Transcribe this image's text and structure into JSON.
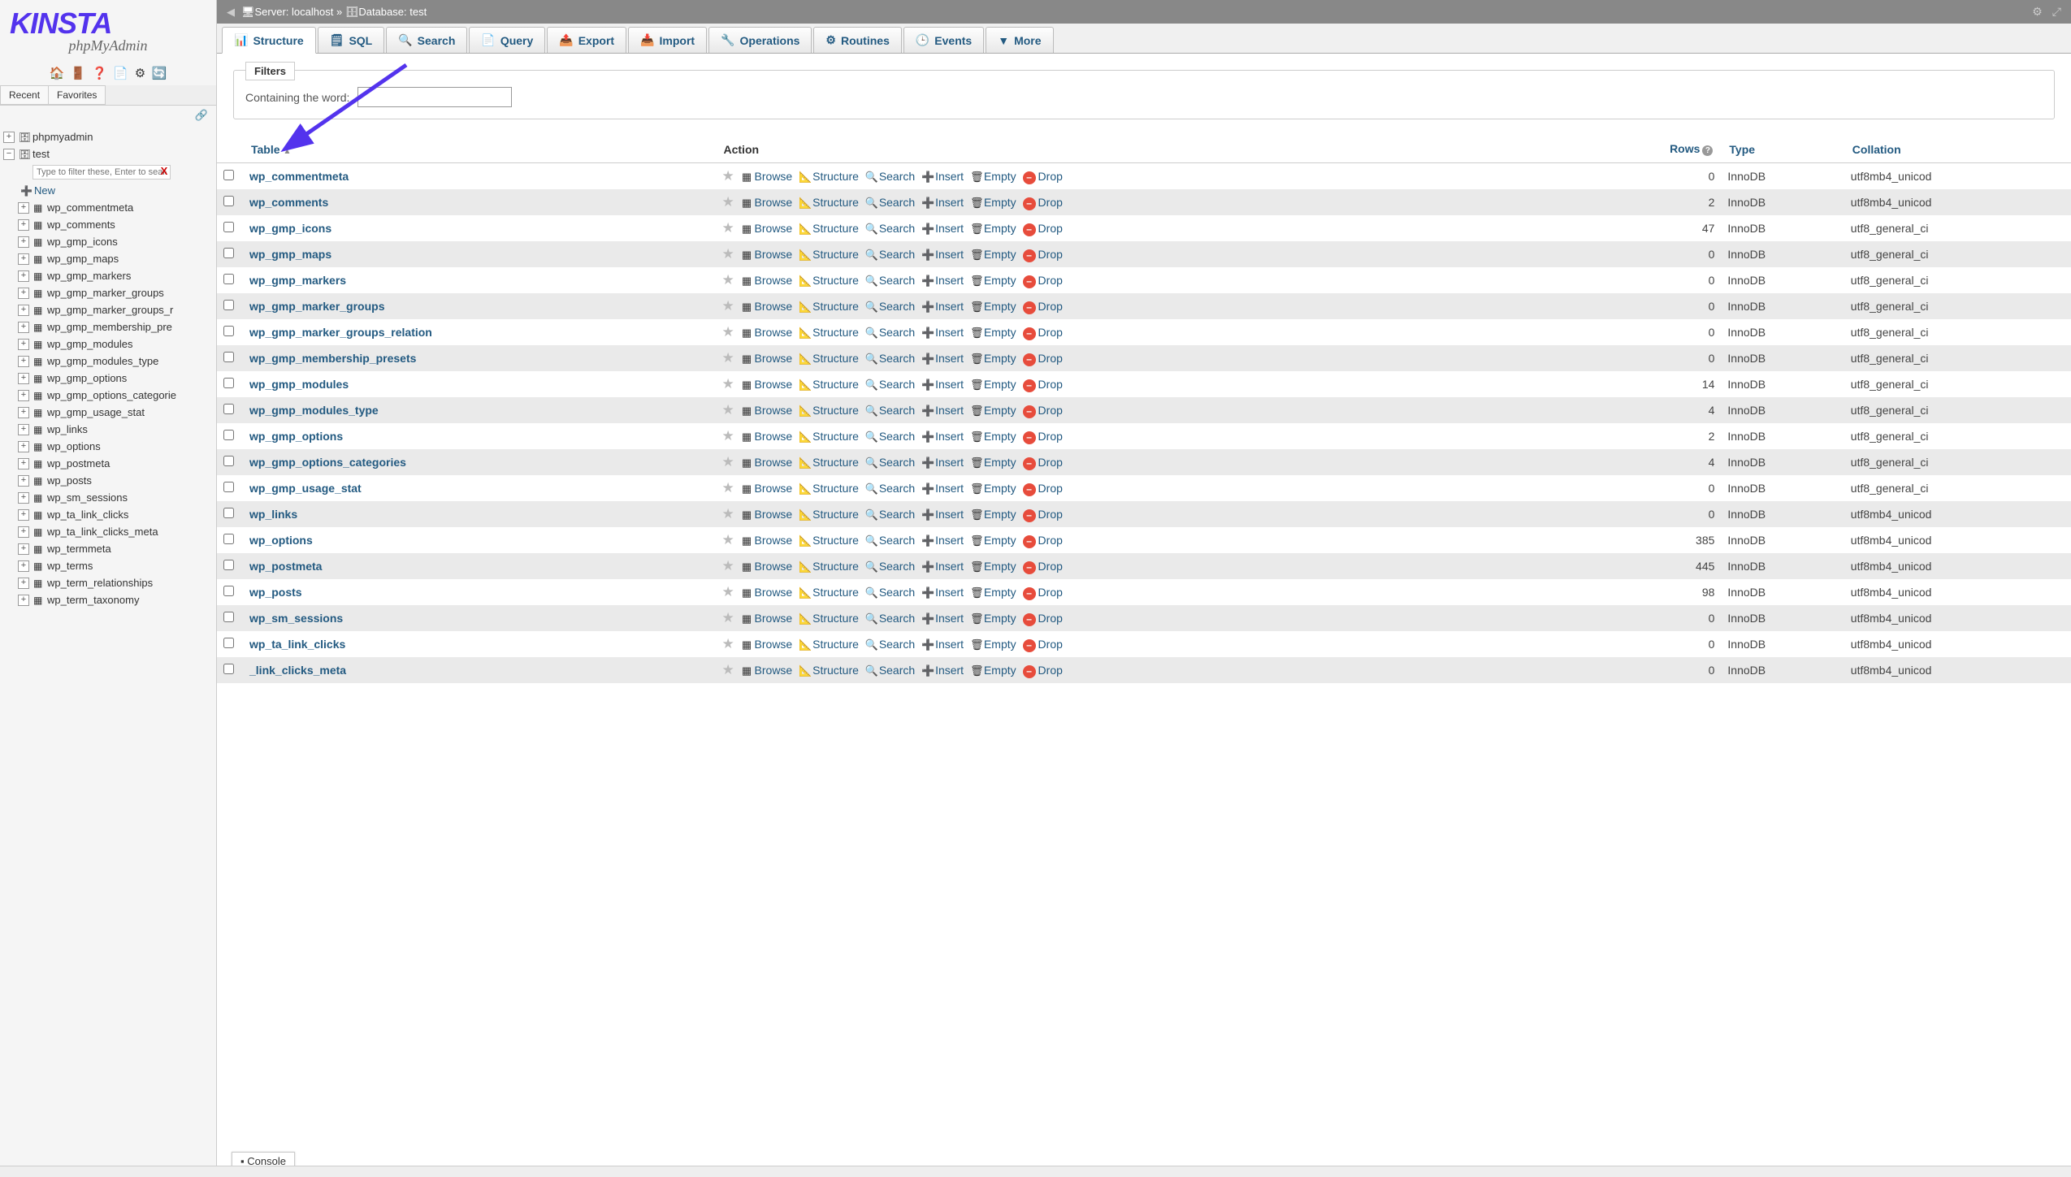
{
  "logo_brand": "KINSTA",
  "logo_sub": "phpMyAdmin",
  "sidebar_tabs": {
    "recent": "Recent",
    "favorites": "Favorites"
  },
  "tree": {
    "root": "phpmyadmin",
    "db": "test",
    "filter_placeholder": "Type to filter these, Enter to search",
    "new_label": "New",
    "tables": [
      "wp_commentmeta",
      "wp_comments",
      "wp_gmp_icons",
      "wp_gmp_maps",
      "wp_gmp_markers",
      "wp_gmp_marker_groups",
      "wp_gmp_marker_groups_r",
      "wp_gmp_membership_pre",
      "wp_gmp_modules",
      "wp_gmp_modules_type",
      "wp_gmp_options",
      "wp_gmp_options_categorie",
      "wp_gmp_usage_stat",
      "wp_links",
      "wp_options",
      "wp_postmeta",
      "wp_posts",
      "wp_sm_sessions",
      "wp_ta_link_clicks",
      "wp_ta_link_clicks_meta",
      "wp_termmeta",
      "wp_terms",
      "wp_term_relationships",
      "wp_term_taxonomy"
    ]
  },
  "breadcrumb": {
    "server_label": "Server:",
    "server": "localhost",
    "db_label": "Database:",
    "db": "test"
  },
  "tabs": [
    {
      "label": "Structure",
      "icon": "📊"
    },
    {
      "label": "SQL",
      "icon": "🗒"
    },
    {
      "label": "Search",
      "icon": "🔍"
    },
    {
      "label": "Query",
      "icon": "📄"
    },
    {
      "label": "Export",
      "icon": "📤"
    },
    {
      "label": "Import",
      "icon": "📥"
    },
    {
      "label": "Operations",
      "icon": "🔧"
    },
    {
      "label": "Routines",
      "icon": "⚙"
    },
    {
      "label": "Events",
      "icon": "🕒"
    },
    {
      "label": "More",
      "icon": "▼"
    }
  ],
  "filters": {
    "legend": "Filters",
    "containing": "Containing the word:"
  },
  "headers": {
    "table": "Table",
    "action": "Action",
    "rows": "Rows",
    "type": "Type",
    "collation": "Collation"
  },
  "actions": {
    "browse": "Browse",
    "structure": "Structure",
    "search": "Search",
    "insert": "Insert",
    "empty": "Empty",
    "drop": "Drop"
  },
  "rows": [
    {
      "name": "wp_commentmeta",
      "rows": "0",
      "type": "InnoDB",
      "coll": "utf8mb4_unicod"
    },
    {
      "name": "wp_comments",
      "rows": "2",
      "type": "InnoDB",
      "coll": "utf8mb4_unicod"
    },
    {
      "name": "wp_gmp_icons",
      "rows": "47",
      "type": "InnoDB",
      "coll": "utf8_general_ci"
    },
    {
      "name": "wp_gmp_maps",
      "rows": "0",
      "type": "InnoDB",
      "coll": "utf8_general_ci"
    },
    {
      "name": "wp_gmp_markers",
      "rows": "0",
      "type": "InnoDB",
      "coll": "utf8_general_ci"
    },
    {
      "name": "wp_gmp_marker_groups",
      "rows": "0",
      "type": "InnoDB",
      "coll": "utf8_general_ci"
    },
    {
      "name": "wp_gmp_marker_groups_relation",
      "rows": "0",
      "type": "InnoDB",
      "coll": "utf8_general_ci"
    },
    {
      "name": "wp_gmp_membership_presets",
      "rows": "0",
      "type": "InnoDB",
      "coll": "utf8_general_ci"
    },
    {
      "name": "wp_gmp_modules",
      "rows": "14",
      "type": "InnoDB",
      "coll": "utf8_general_ci"
    },
    {
      "name": "wp_gmp_modules_type",
      "rows": "4",
      "type": "InnoDB",
      "coll": "utf8_general_ci"
    },
    {
      "name": "wp_gmp_options",
      "rows": "2",
      "type": "InnoDB",
      "coll": "utf8_general_ci"
    },
    {
      "name": "wp_gmp_options_categories",
      "rows": "4",
      "type": "InnoDB",
      "coll": "utf8_general_ci"
    },
    {
      "name": "wp_gmp_usage_stat",
      "rows": "0",
      "type": "InnoDB",
      "coll": "utf8_general_ci"
    },
    {
      "name": "wp_links",
      "rows": "0",
      "type": "InnoDB",
      "coll": "utf8mb4_unicod"
    },
    {
      "name": "wp_options",
      "rows": "385",
      "type": "InnoDB",
      "coll": "utf8mb4_unicod"
    },
    {
      "name": "wp_postmeta",
      "rows": "445",
      "type": "InnoDB",
      "coll": "utf8mb4_unicod"
    },
    {
      "name": "wp_posts",
      "rows": "98",
      "type": "InnoDB",
      "coll": "utf8mb4_unicod"
    },
    {
      "name": "wp_sm_sessions",
      "rows": "0",
      "type": "InnoDB",
      "coll": "utf8mb4_unicod"
    },
    {
      "name": "wp_ta_link_clicks",
      "rows": "0",
      "type": "InnoDB",
      "coll": "utf8mb4_unicod"
    },
    {
      "name": "_link_clicks_meta",
      "rows": "0",
      "type": "InnoDB",
      "coll": "utf8mb4_unicod"
    }
  ],
  "console_label": "Console"
}
